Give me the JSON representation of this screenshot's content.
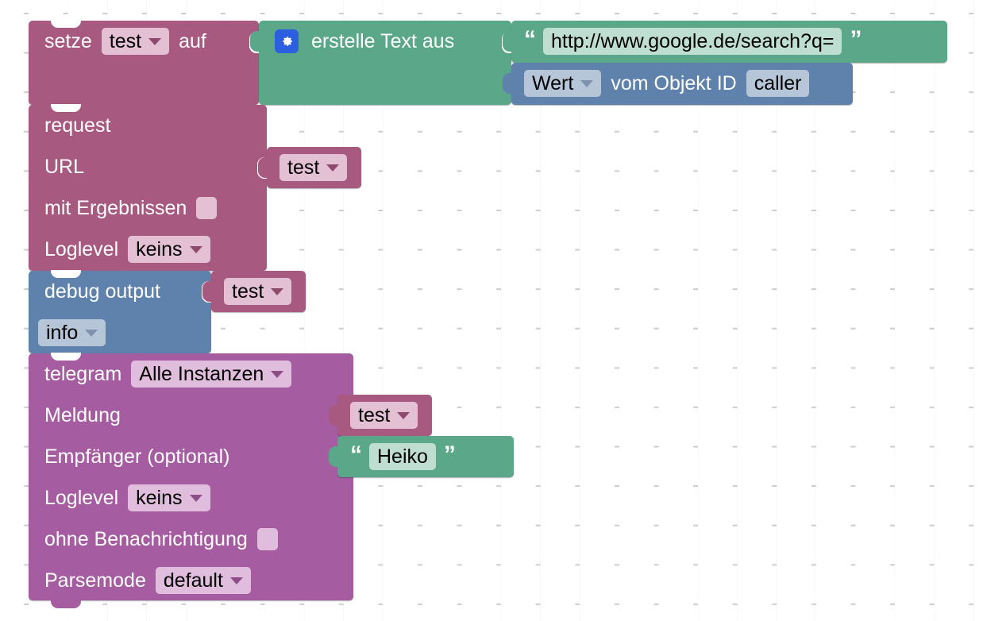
{
  "workspace": {
    "background_color": "#ffffff",
    "grid_color": "#cccccc",
    "grid_spacing": 49.6
  },
  "palette": {
    "variable_rose": "#a8597f",
    "text_green": "#5aa78a",
    "debug_blue": "#5e82ab",
    "telegram_magenta": "#a65ca0",
    "field_rose": "#e3c0d4",
    "field_green": "#bfded2",
    "field_blue": "#b6c5d8",
    "field_magenta": "#e0bcdd",
    "gear_button": "#2c5fe0"
  },
  "blocks": {
    "set_variable": {
      "label_set": "setze",
      "variable": "test",
      "label_to": "auf"
    },
    "create_text": {
      "gear_icon": "gear-icon",
      "label": "erstelle Text aus"
    },
    "text_url": {
      "open_quote": "“",
      "value": "http://www.google.de/search?q=",
      "close_quote": "”"
    },
    "get_object_value": {
      "attribute": "Wert",
      "label_middle": "vom Objekt ID",
      "object_id": "caller"
    },
    "http_request": {
      "title": "request",
      "label_url": "URL",
      "url_variable": "test",
      "label_with_results": "mit Ergebnissen",
      "with_results_checked": false,
      "label_loglevel": "Loglevel",
      "loglevel": "keins"
    },
    "debug_output": {
      "title": "debug output",
      "message_variable": "test",
      "severity": "info"
    },
    "telegram": {
      "title": "telegram",
      "instance": "Alle Instanzen",
      "label_message": "Meldung",
      "message_variable": "test",
      "label_recipient": "Empfänger (optional)",
      "recipient_open_quote": "“",
      "recipient_value": "Heiko",
      "recipient_close_quote": "”",
      "label_loglevel": "Loglevel",
      "loglevel": "keins",
      "label_silent": "ohne Benachrichtigung",
      "silent_checked": false,
      "label_parsemode": "Parsemode",
      "parsemode": "default"
    }
  }
}
